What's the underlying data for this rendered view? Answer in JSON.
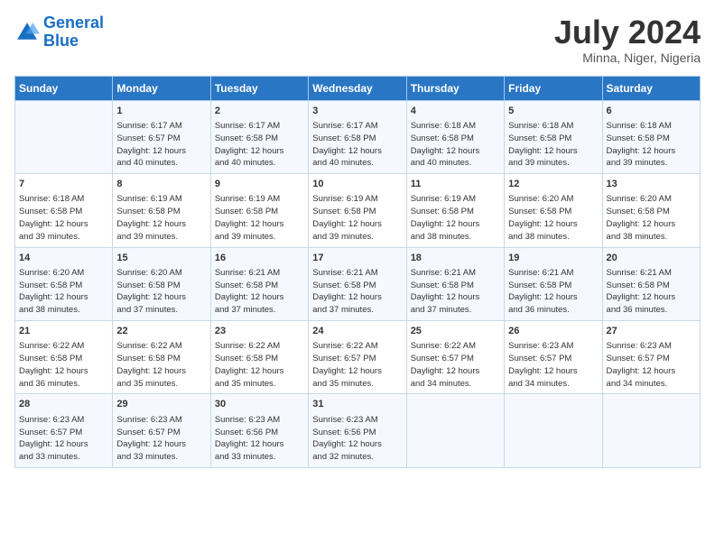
{
  "header": {
    "logo_line1": "General",
    "logo_line2": "Blue",
    "month_year": "July 2024",
    "location": "Minna, Niger, Nigeria"
  },
  "days_of_week": [
    "Sunday",
    "Monday",
    "Tuesday",
    "Wednesday",
    "Thursday",
    "Friday",
    "Saturday"
  ],
  "weeks": [
    [
      {
        "num": "",
        "info": ""
      },
      {
        "num": "1",
        "info": "Sunrise: 6:17 AM\nSunset: 6:57 PM\nDaylight: 12 hours\nand 40 minutes."
      },
      {
        "num": "2",
        "info": "Sunrise: 6:17 AM\nSunset: 6:58 PM\nDaylight: 12 hours\nand 40 minutes."
      },
      {
        "num": "3",
        "info": "Sunrise: 6:17 AM\nSunset: 6:58 PM\nDaylight: 12 hours\nand 40 minutes."
      },
      {
        "num": "4",
        "info": "Sunrise: 6:18 AM\nSunset: 6:58 PM\nDaylight: 12 hours\nand 40 minutes."
      },
      {
        "num": "5",
        "info": "Sunrise: 6:18 AM\nSunset: 6:58 PM\nDaylight: 12 hours\nand 39 minutes."
      },
      {
        "num": "6",
        "info": "Sunrise: 6:18 AM\nSunset: 6:58 PM\nDaylight: 12 hours\nand 39 minutes."
      }
    ],
    [
      {
        "num": "7",
        "info": "Sunrise: 6:18 AM\nSunset: 6:58 PM\nDaylight: 12 hours\nand 39 minutes."
      },
      {
        "num": "8",
        "info": "Sunrise: 6:19 AM\nSunset: 6:58 PM\nDaylight: 12 hours\nand 39 minutes."
      },
      {
        "num": "9",
        "info": "Sunrise: 6:19 AM\nSunset: 6:58 PM\nDaylight: 12 hours\nand 39 minutes."
      },
      {
        "num": "10",
        "info": "Sunrise: 6:19 AM\nSunset: 6:58 PM\nDaylight: 12 hours\nand 39 minutes."
      },
      {
        "num": "11",
        "info": "Sunrise: 6:19 AM\nSunset: 6:58 PM\nDaylight: 12 hours\nand 38 minutes."
      },
      {
        "num": "12",
        "info": "Sunrise: 6:20 AM\nSunset: 6:58 PM\nDaylight: 12 hours\nand 38 minutes."
      },
      {
        "num": "13",
        "info": "Sunrise: 6:20 AM\nSunset: 6:58 PM\nDaylight: 12 hours\nand 38 minutes."
      }
    ],
    [
      {
        "num": "14",
        "info": "Sunrise: 6:20 AM\nSunset: 6:58 PM\nDaylight: 12 hours\nand 38 minutes."
      },
      {
        "num": "15",
        "info": "Sunrise: 6:20 AM\nSunset: 6:58 PM\nDaylight: 12 hours\nand 37 minutes."
      },
      {
        "num": "16",
        "info": "Sunrise: 6:21 AM\nSunset: 6:58 PM\nDaylight: 12 hours\nand 37 minutes."
      },
      {
        "num": "17",
        "info": "Sunrise: 6:21 AM\nSunset: 6:58 PM\nDaylight: 12 hours\nand 37 minutes."
      },
      {
        "num": "18",
        "info": "Sunrise: 6:21 AM\nSunset: 6:58 PM\nDaylight: 12 hours\nand 37 minutes."
      },
      {
        "num": "19",
        "info": "Sunrise: 6:21 AM\nSunset: 6:58 PM\nDaylight: 12 hours\nand 36 minutes."
      },
      {
        "num": "20",
        "info": "Sunrise: 6:21 AM\nSunset: 6:58 PM\nDaylight: 12 hours\nand 36 minutes."
      }
    ],
    [
      {
        "num": "21",
        "info": "Sunrise: 6:22 AM\nSunset: 6:58 PM\nDaylight: 12 hours\nand 36 minutes."
      },
      {
        "num": "22",
        "info": "Sunrise: 6:22 AM\nSunset: 6:58 PM\nDaylight: 12 hours\nand 35 minutes."
      },
      {
        "num": "23",
        "info": "Sunrise: 6:22 AM\nSunset: 6:58 PM\nDaylight: 12 hours\nand 35 minutes."
      },
      {
        "num": "24",
        "info": "Sunrise: 6:22 AM\nSunset: 6:57 PM\nDaylight: 12 hours\nand 35 minutes."
      },
      {
        "num": "25",
        "info": "Sunrise: 6:22 AM\nSunset: 6:57 PM\nDaylight: 12 hours\nand 34 minutes."
      },
      {
        "num": "26",
        "info": "Sunrise: 6:23 AM\nSunset: 6:57 PM\nDaylight: 12 hours\nand 34 minutes."
      },
      {
        "num": "27",
        "info": "Sunrise: 6:23 AM\nSunset: 6:57 PM\nDaylight: 12 hours\nand 34 minutes."
      }
    ],
    [
      {
        "num": "28",
        "info": "Sunrise: 6:23 AM\nSunset: 6:57 PM\nDaylight: 12 hours\nand 33 minutes."
      },
      {
        "num": "29",
        "info": "Sunrise: 6:23 AM\nSunset: 6:57 PM\nDaylight: 12 hours\nand 33 minutes."
      },
      {
        "num": "30",
        "info": "Sunrise: 6:23 AM\nSunset: 6:56 PM\nDaylight: 12 hours\nand 33 minutes."
      },
      {
        "num": "31",
        "info": "Sunrise: 6:23 AM\nSunset: 6:56 PM\nDaylight: 12 hours\nand 32 minutes."
      },
      {
        "num": "",
        "info": ""
      },
      {
        "num": "",
        "info": ""
      },
      {
        "num": "",
        "info": ""
      }
    ]
  ]
}
